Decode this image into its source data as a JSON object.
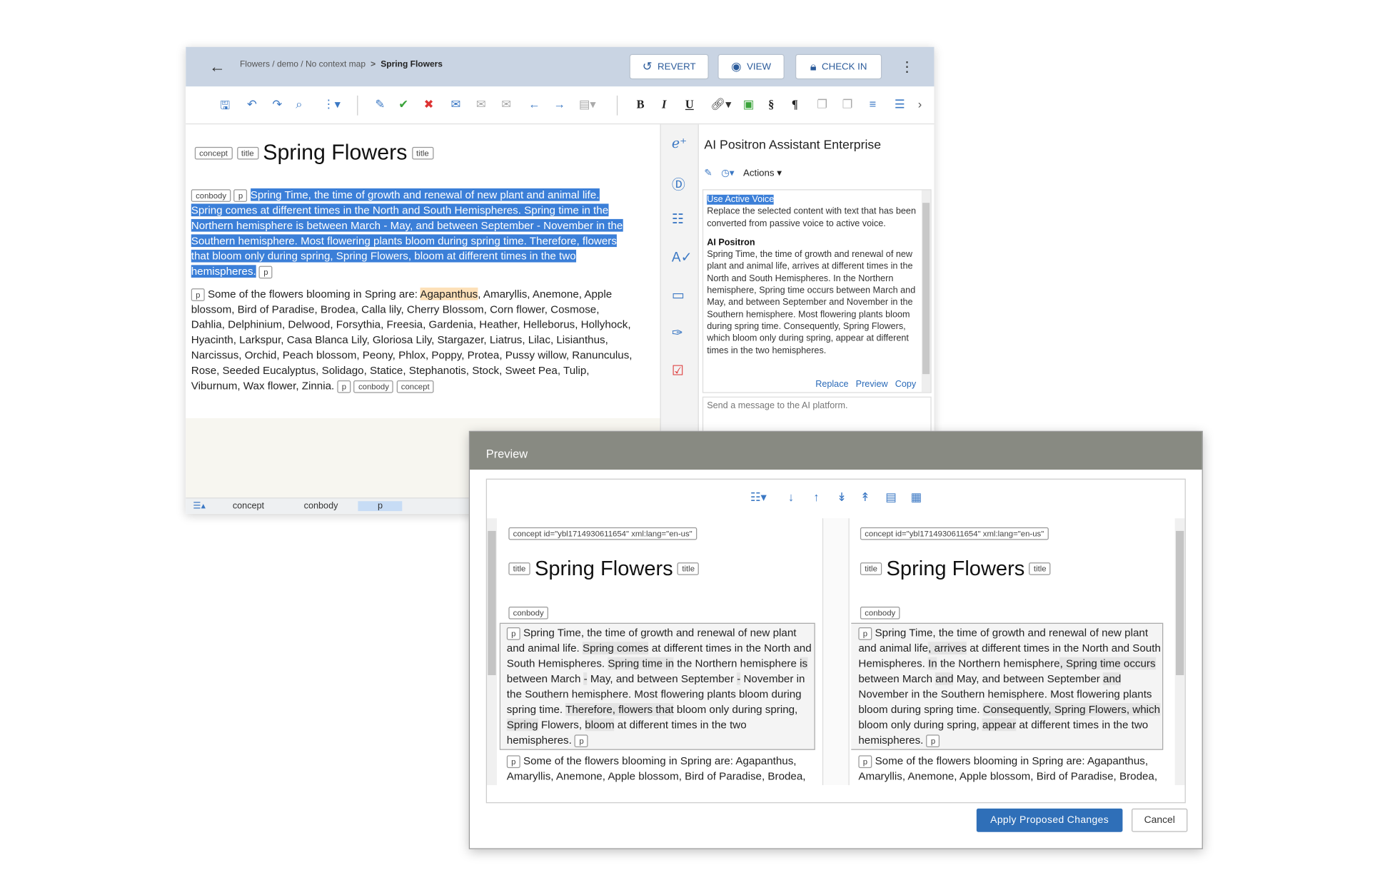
{
  "editor": {
    "breadcrumb": {
      "path": "Flowers / demo / ",
      "map": "No context map",
      "sep": ">",
      "current": "Spring Flowers"
    },
    "buttons": {
      "revert": "REVERT",
      "view": "VIEW",
      "checkin": "CHECK IN"
    },
    "doc": {
      "tags": {
        "concept": "concept",
        "title": "title",
        "conbody": "conbody",
        "p": "p"
      },
      "title": "Spring Flowers",
      "selected_paragraph": "Spring Time, the time of growth and renewal of new plant and animal life. Spring comes at different times in the North and South Hemispheres. Spring time in the Northern hemisphere is between March - May, and between September - November in the Southern hemisphere. Most flowering plants bloom during spring time. Therefore, flowers that bloom only during spring, Spring Flowers, bloom at different times in the two hemispheres.",
      "para2_intro": "Some of the flowers blooming in Spring are: ",
      "para2_highlight": "Agapanthus",
      "para2_rest": ", Amaryllis, Anemone, Apple blossom, Bird of Paradise, Brodea, Calla lily, Cherry Blossom, Corn flower, Cosmose, Dahlia, Delphinium, Delwood, Forsythia, Freesia, Gardenia, Heather, Helleborus, Hollyhock, Hyacinth, Larkspur, Casa Blanca Lily, Gloriosa Lily, Stargazer, Liatrus, Lilac, Lisianthus, Narcissus, Orchid, Peach blossom, Peony, Phlox, Poppy, Protea, Pussy willow, Ranunculus, Rose, Seeded Eucalyptus, Solidago, Statice, Stephanotis, Stock, Sweet Pea, Tulip, Viburnum, Wax flower, Zinnia."
    },
    "statusbar": [
      "concept",
      "conbody",
      "p"
    ]
  },
  "ai_panel": {
    "title": "AI Positron Assistant Enterprise",
    "actions_label": "Actions",
    "action_name": "Use Active Voice",
    "action_desc": "Replace the selected content with text that has been converted from passive voice to active voice.",
    "responder": "AI Positron",
    "response": "Spring Time, the time of growth and renewal of new plant and animal life, arrives at different times in the North and South Hemispheres. In the Northern hemisphere, Spring time occurs between March and May, and between September and November in the Southern hemisphere. Most flowering plants bloom during spring time. Consequently, Spring Flowers, which bloom only during spring, appear at different times in the two hemispheres.",
    "links": {
      "replace": "Replace",
      "preview": "Preview",
      "copy": "Copy"
    },
    "message_placeholder": "Send a message to the AI platform."
  },
  "preview": {
    "title": "Preview",
    "concept_tag": "concept id=\"ybl1714930611654\" xml:lang=\"en-us\"",
    "doc_title": "Spring Flowers",
    "tags": {
      "title": "title",
      "conbody": "conbody",
      "p": "p"
    },
    "left_para3": "Some of the flowers blooming in Spring are: Agapanthus, Amaryllis, Anemone, Apple blossom, Bird of Paradise, Brodea,",
    "right_para3": "Some of the flowers blooming in Spring are: Agapanthus, Amaryllis, Anemone, Apple blossom, Bird of Paradise, Brodea,",
    "buttons": {
      "apply": "Apply Proposed Changes",
      "cancel": "Cancel"
    }
  }
}
